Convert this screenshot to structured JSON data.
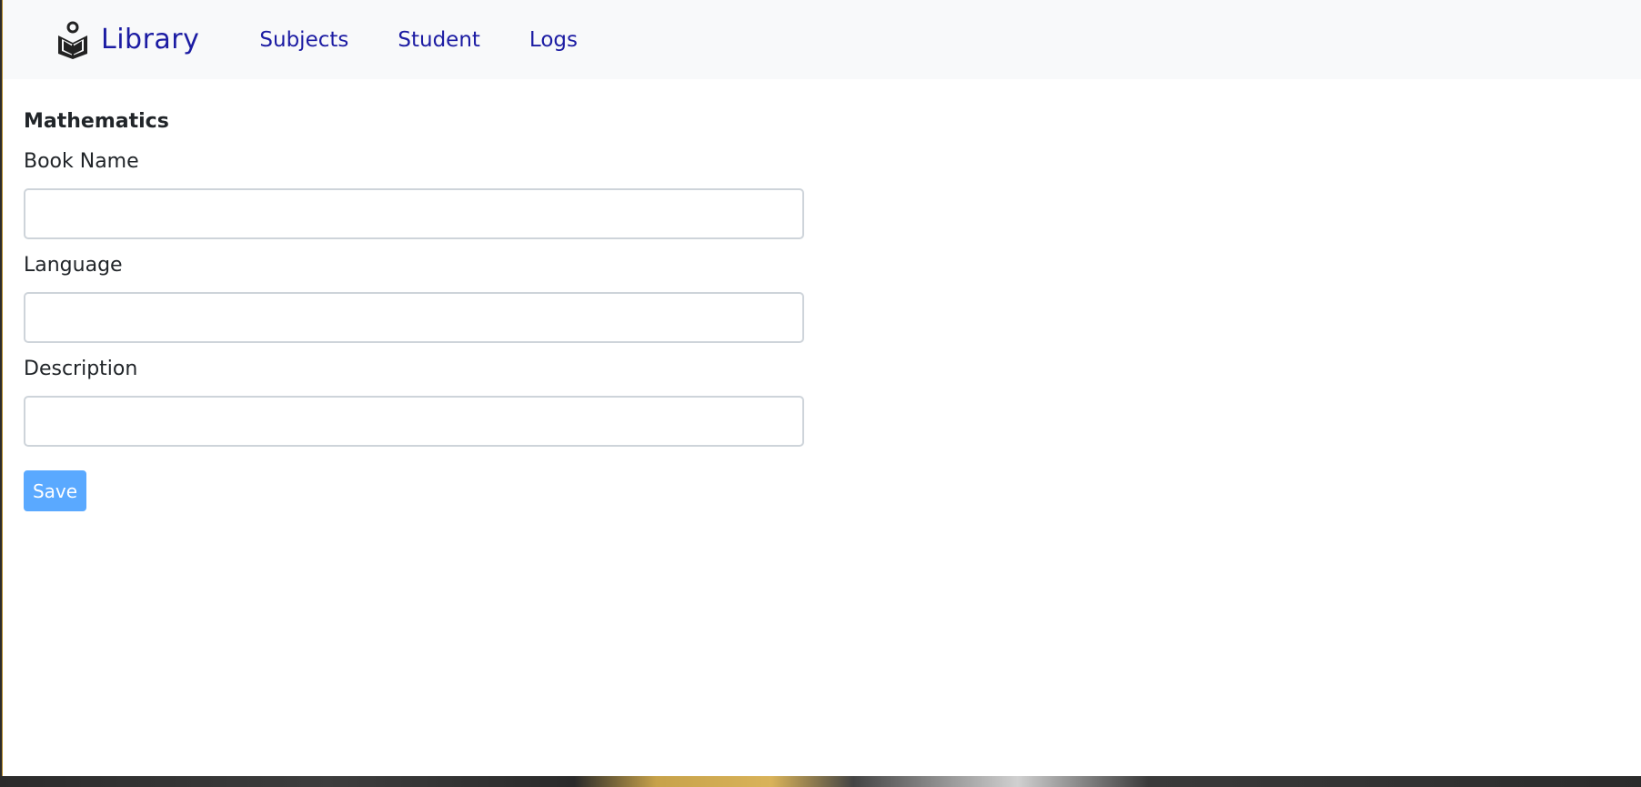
{
  "navbar": {
    "brand_label": "Library",
    "brand_icon": "book-reader-icon",
    "links": [
      "Subjects",
      "Student",
      "Logs"
    ]
  },
  "form": {
    "title": "Mathematics",
    "fields": [
      {
        "label": "Book Name",
        "value": "",
        "placeholder": ""
      },
      {
        "label": "Language",
        "value": "",
        "placeholder": ""
      },
      {
        "label": "Description",
        "value": "",
        "placeholder": ""
      }
    ],
    "save_label": "Save"
  },
  "colors": {
    "nav_link": "#1c1ca3",
    "navbar_bg": "#f8f9fa",
    "save_button_bg": "#5aa9ff"
  }
}
